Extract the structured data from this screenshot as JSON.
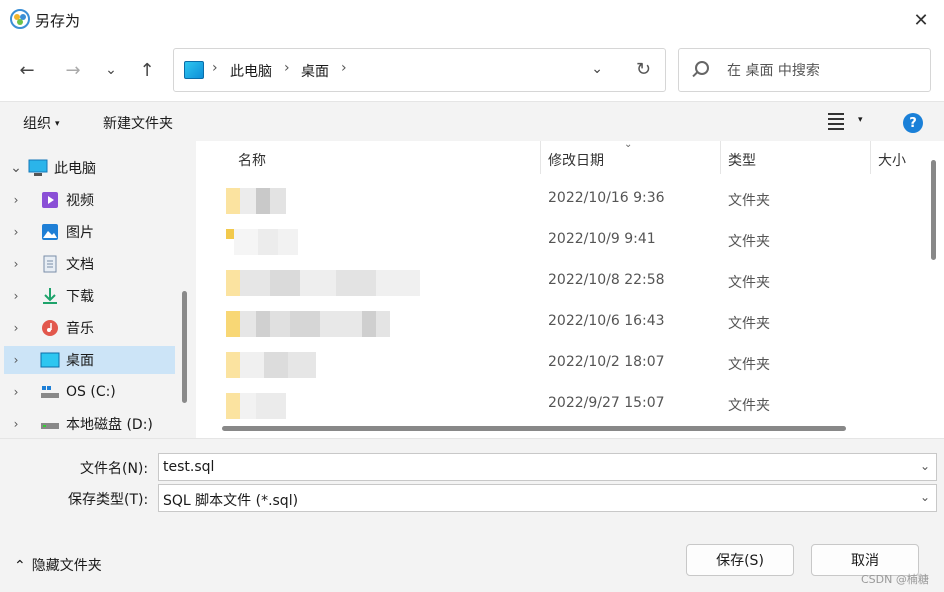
{
  "window": {
    "title": "另存为",
    "close_icon": "✕"
  },
  "nav": {
    "back_icon": "←",
    "forward_icon": "→",
    "recent_icon": "⌄",
    "up_icon": "↑",
    "breadcrumbs": [
      "此电脑",
      "桌面"
    ],
    "separator": "›",
    "dropdown_icon": "⌄",
    "refresh_icon": "↻"
  },
  "search": {
    "placeholder": "在 桌面 中搜索"
  },
  "toolbar": {
    "organize": "组织",
    "caret": "▾",
    "new_folder": "新建文件夹",
    "help": "?"
  },
  "sidebar": {
    "items": [
      {
        "label": "此电脑",
        "icon": "computer-icon",
        "chevron": "⌄",
        "selected": false
      },
      {
        "label": "视频",
        "icon": "video-icon",
        "chevron": "›",
        "selected": false
      },
      {
        "label": "图片",
        "icon": "picture-icon",
        "chevron": "›",
        "selected": false
      },
      {
        "label": "文档",
        "icon": "document-icon",
        "chevron": "›",
        "selected": false
      },
      {
        "label": "下载",
        "icon": "download-icon",
        "chevron": "›",
        "selected": false
      },
      {
        "label": "音乐",
        "icon": "music-icon",
        "chevron": "›",
        "selected": false
      },
      {
        "label": "桌面",
        "icon": "desktop-icon",
        "chevron": "›",
        "selected": true
      },
      {
        "label": "OS (C:)",
        "icon": "drive-icon",
        "chevron": "›",
        "selected": false
      },
      {
        "label": "本地磁盘 (D:)",
        "icon": "drive-icon",
        "chevron": "›",
        "selected": false
      }
    ]
  },
  "filelist": {
    "columns": [
      "名称",
      "修改日期",
      "类型",
      "大小"
    ],
    "sort_icon": "⌄",
    "rows": [
      {
        "name": "",
        "modified": "2022/10/16 9:36",
        "type": "文件夹"
      },
      {
        "name": "",
        "modified": "2022/10/9 9:41",
        "type": "文件夹"
      },
      {
        "name": "",
        "modified": "2022/10/8 22:58",
        "type": "文件夹"
      },
      {
        "name": "",
        "modified": "2022/10/6 16:43",
        "type": "文件夹"
      },
      {
        "name": "",
        "modified": "2022/10/2 18:07",
        "type": "文件夹"
      },
      {
        "name": "",
        "modified": "2022/9/27 15:07",
        "type": "文件夹"
      }
    ]
  },
  "form": {
    "filename_label": "文件名(N):",
    "filename_value": "test.sql",
    "filetype_label": "保存类型(T):",
    "filetype_value": "SQL 脚本文件 (*.sql)",
    "dropdown_icon": "⌄"
  },
  "bottom": {
    "hide_folders": "隐藏文件夹",
    "hide_caret": "⌃",
    "save": "保存(S)",
    "cancel": "取消",
    "watermark": "CSDN @楠糖"
  },
  "colors": {
    "accent": "#1a80d8",
    "selection": "#cce4f7",
    "folder": "#f8d775"
  }
}
